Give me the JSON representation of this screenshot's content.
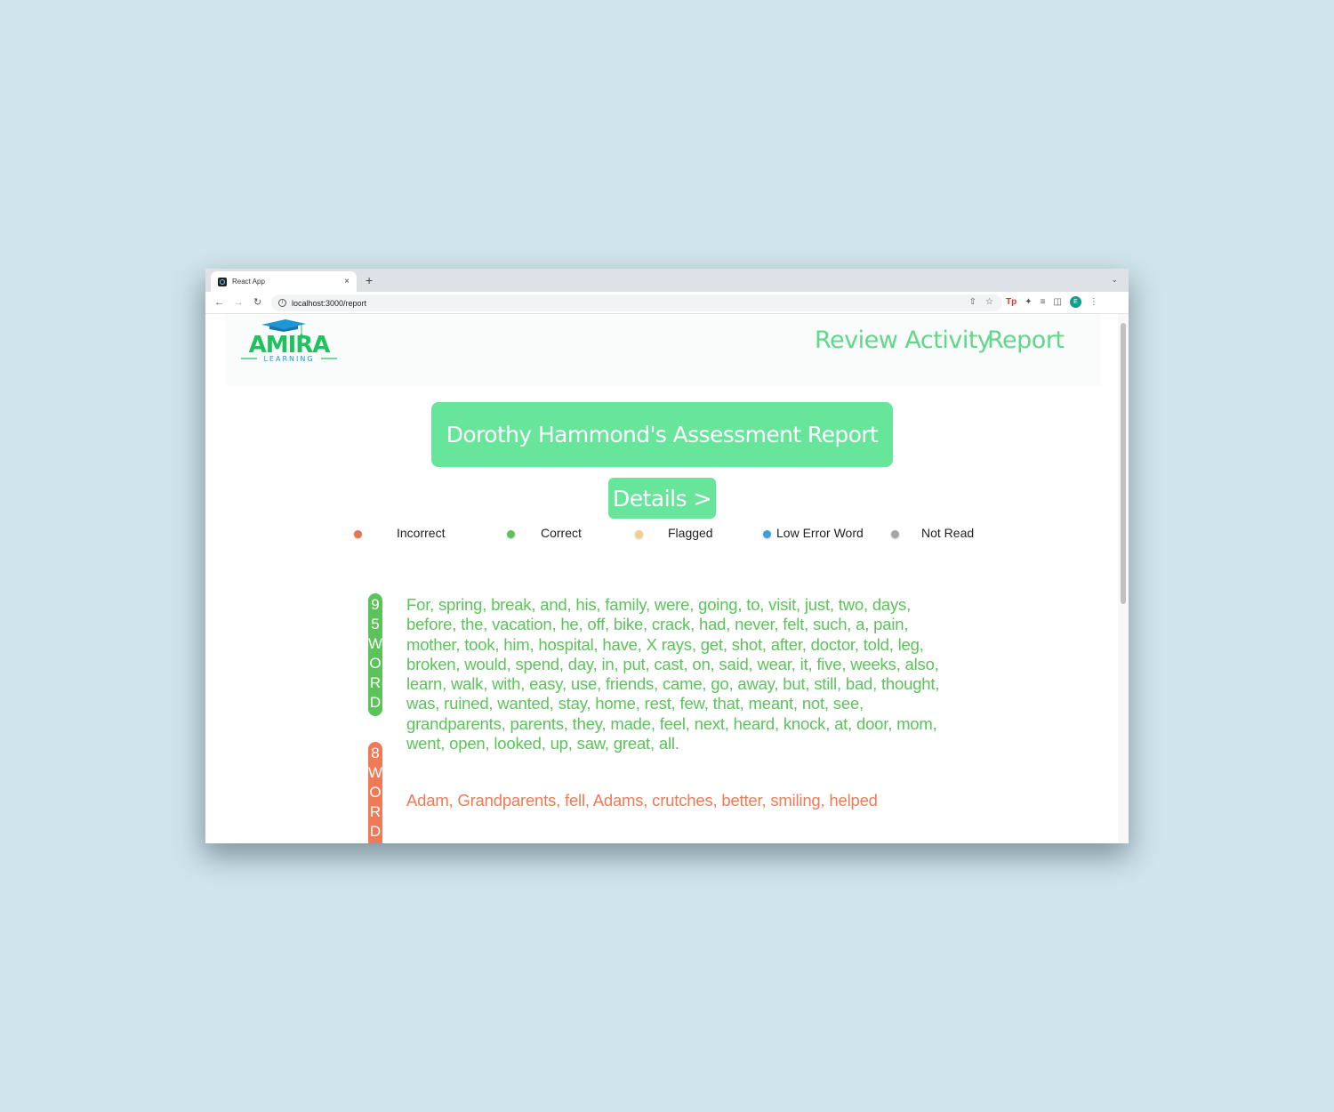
{
  "browser": {
    "tab_title": "React App",
    "tab_close": "×",
    "new_tab": "+",
    "url": "localhost:3000/report",
    "profile_initial": "E",
    "tp_label": "Tp"
  },
  "app": {
    "logo_text": "AMIRA",
    "logo_subtext": "LEARNING",
    "nav": {
      "review_activity": "Review Activity",
      "report": "Report"
    },
    "title": "Dorothy Hammond's Assessment Report",
    "details_label": "Details >"
  },
  "legend": [
    {
      "label": "Incorrect",
      "color": "#e8734f"
    },
    {
      "label": "Correct",
      "color": "#5cc25a"
    },
    {
      "label": "Flagged",
      "color": "#f3d08a"
    },
    {
      "label": "Low Error Word",
      "color": "#3aa0dc"
    },
    {
      "label": "Not Read",
      "color": "#a6a6a6"
    }
  ],
  "word_groups": [
    {
      "count_chars": [
        "9",
        "5",
        "W",
        "O",
        "R",
        "D"
      ],
      "color": "#5cc25a",
      "words": "For, spring, break, and, his, family, were, going, to, visit, just, two, days, before, the, vacation, he, off, bike, crack, had, never, felt, such, a, pain, mother, took, him, hospital, have, X rays, get, shot, after, doctor, told, leg, broken, would, spend, day, in, put, cast, on, said, wear, it, five, weeks, also, learn, walk, with, easy, use, friends, came, go, away, but, still, bad, thought, was, ruined, wanted, stay, home, rest, few, that, meant, not, see, grandparents, parents, they, made, feel, next, heard, knock, at, door, mom, went, open, looked, up, saw, great, all."
    },
    {
      "count_chars": [
        "8",
        "W",
        "O",
        "R",
        "D"
      ],
      "color": "#ef7a57",
      "words": "Adam, Grandparents, fell, Adams, crutches, better, smiling, helped"
    }
  ]
}
